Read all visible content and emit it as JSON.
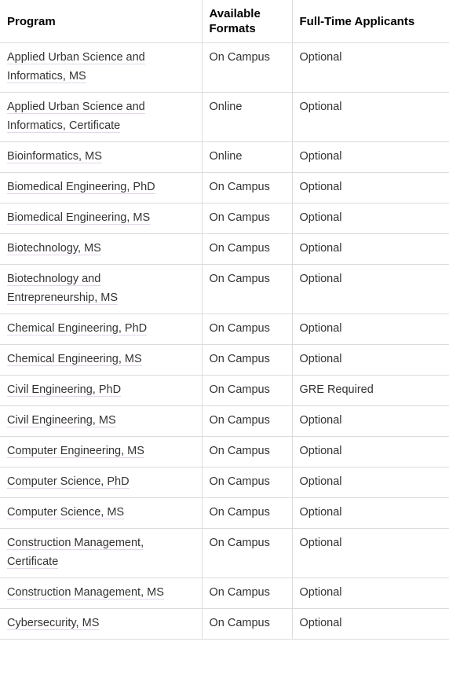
{
  "table": {
    "name": "graduate-program-requirements-table",
    "columns": [
      {
        "key": "program",
        "label": "Program"
      },
      {
        "key": "formats",
        "label": "Available Formats"
      },
      {
        "key": "applicants",
        "label": "Full-Time Applicants"
      }
    ],
    "rows": [
      {
        "program": "Applied Urban Science and Informatics, MS",
        "formats": "On Campus",
        "applicants": "Optional",
        "wrap_format": false
      },
      {
        "program": "Applied Urban Science and Informatics, Certificate",
        "formats": "Online",
        "applicants": "Optional",
        "wrap_format": false
      },
      {
        "program": "Bioinformatics, MS",
        "formats": "Online",
        "applicants": "Optional",
        "wrap_format": false
      },
      {
        "program": "Biomedical Engineering, PhD",
        "formats": "On Campus",
        "applicants": "Optional",
        "wrap_format": false
      },
      {
        "program": "Biomedical Engineering, MS",
        "formats": "On Campus",
        "applicants": "Optional",
        "wrap_format": false
      },
      {
        "program": "Biotechnology, MS",
        "formats": "On Campus",
        "applicants": "Optional",
        "wrap_format": false
      },
      {
        "program": "Biotechnology and Entrepreneurship, MS",
        "formats": "On Campus",
        "applicants": "Optional",
        "wrap_format": false
      },
      {
        "program": "Chemical Engineering, PhD",
        "formats": "On Campus",
        "applicants": "Optional",
        "wrap_format": false
      },
      {
        "program": "Chemical Engineering, MS",
        "formats": "On Campus",
        "applicants": "Optional",
        "wrap_format": false
      },
      {
        "program": "Civil Engineering, PhD",
        "formats": "On Campus",
        "applicants": "GRE Required",
        "wrap_format": true
      },
      {
        "program": "Civil Engineering, MS",
        "formats": "On Campus",
        "applicants": "Optional",
        "wrap_format": true
      },
      {
        "program": "Computer Engineering, MS",
        "formats": "On Campus",
        "applicants": "Optional",
        "wrap_format": false
      },
      {
        "program": "Computer Science, PhD",
        "formats": "On Campus",
        "applicants": "Optional",
        "wrap_format": true
      },
      {
        "program": "Computer Science, MS",
        "formats": "On Campus",
        "applicants": "Optional",
        "wrap_format": true
      },
      {
        "program": "Construction Management, Certificate",
        "formats": "On Campus",
        "applicants": "Optional",
        "wrap_format": false
      },
      {
        "program": "Construction Management, MS",
        "formats": "On Campus",
        "applicants": "Optional",
        "wrap_format": false
      },
      {
        "program": "Cybersecurity, MS",
        "formats": "On Campus",
        "applicants": "Optional",
        "wrap_format": true
      }
    ]
  },
  "colors": {
    "border": "#dcdcdc",
    "link_underline": "#e3d7ea",
    "body_text": "#333333",
    "header_text": "#010101"
  }
}
